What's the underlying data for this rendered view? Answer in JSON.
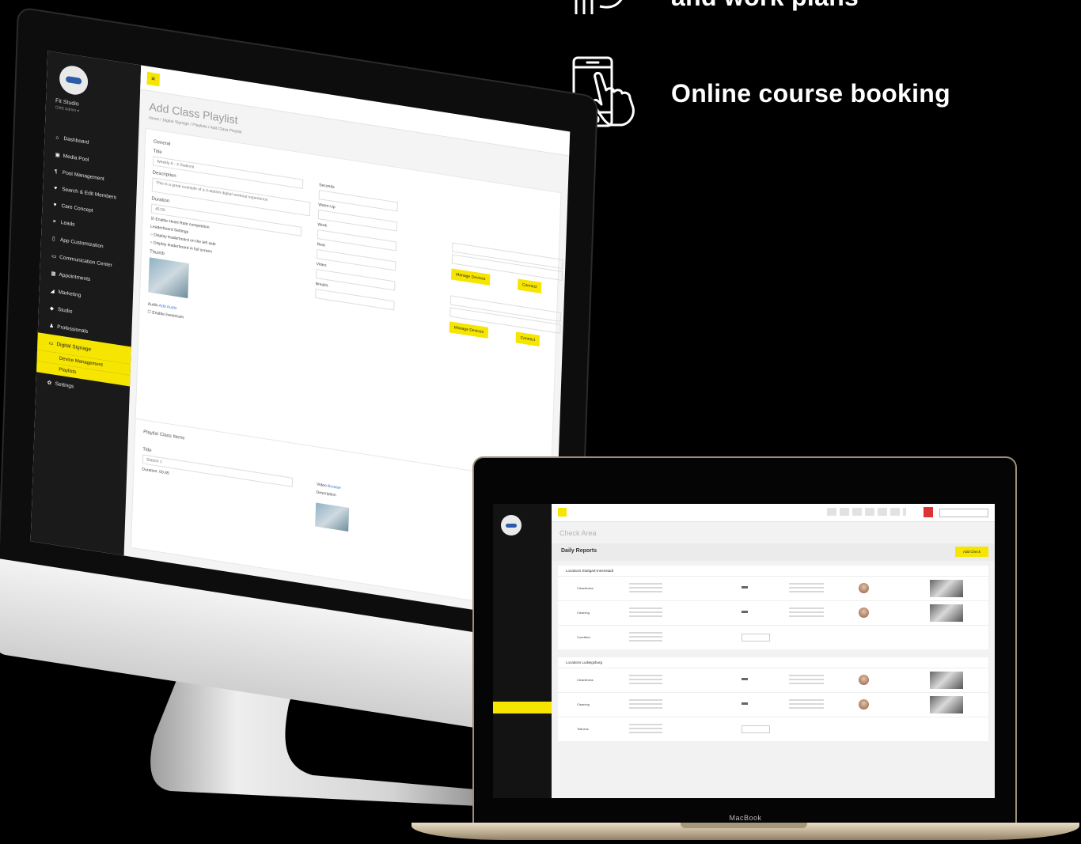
{
  "features": [
    {
      "label": "and work plans",
      "icon": "checklist-icon"
    },
    {
      "label": "Online course booking",
      "icon": "phone-tap-icon"
    }
  ],
  "imac": {
    "sidebar": {
      "studio_name": "Fit Studio",
      "studio_sub": "CMS Admin ▾",
      "items": [
        {
          "label": "Dashboard",
          "icon": "home-icon"
        },
        {
          "label": "Media Pool",
          "icon": "image-icon"
        },
        {
          "label": "Post Management",
          "icon": "pin-icon"
        },
        {
          "label": "Search & Edit Members",
          "icon": "users-icon"
        },
        {
          "label": "Care Concept",
          "icon": "heart-icon"
        },
        {
          "label": "Leads",
          "icon": "list-icon"
        },
        {
          "label": "App Customization",
          "icon": "mobile-icon"
        },
        {
          "label": "Communication Center",
          "icon": "chat-icon"
        },
        {
          "label": "Appointments",
          "icon": "calendar-icon"
        },
        {
          "label": "Marketing",
          "icon": "megaphone-icon"
        },
        {
          "label": "Studio",
          "icon": "building-icon"
        },
        {
          "label": "Professionals",
          "icon": "user-icon"
        },
        {
          "label": "Digital Signage",
          "icon": "monitor-icon",
          "active": true
        },
        {
          "label": "Settings",
          "icon": "gear-icon"
        }
      ],
      "subitems": [
        "Device Management",
        "Playlists"
      ]
    },
    "page_title": "Add Class Playlist",
    "breadcrumb": "Home / Digital Signage / Playlists / Add Class Playlist",
    "form": {
      "section_label": "General",
      "title_label": "Title",
      "title_value": "Weekly A - 4 Stations",
      "description_label": "Description",
      "description_value": "This is a great example of a 4-station digital workout experience",
      "duration_label": "Duration",
      "duration_value": "45:00",
      "heart_rate_label": "Enable Heart Rate competition",
      "leaderboard_label": "Leaderboard Settings",
      "leaderboard_opt1": "Display leaderboard on the left side",
      "leaderboard_opt2": "Display leaderboard in full screen",
      "thumb_label": "Thumb",
      "audio_label": "Audio",
      "add_audio": "Add Audio",
      "enable_livestream": "Enable livestream",
      "seconds_label": "Seconds",
      "warmup_label": "Warm-Up",
      "work_label": "Work",
      "rest_label": "Rest",
      "video_label": "Video",
      "breaks_label": "Breaks",
      "manage_devices": "Manage Devices",
      "connect": "Connect"
    },
    "section2": {
      "title": "Playlist Class Items",
      "item_title_label": "Title",
      "item_title_value": "Station 1",
      "item_duration": "Duration: 00:45",
      "video_label": "Video",
      "no_video": "Browse",
      "file_label": "Description"
    }
  },
  "macbook": {
    "brand_label": "MacBook",
    "page_title": "Check Area",
    "header_title": "Daily Reports",
    "header_button": "Add Check",
    "blocks": [
      {
        "title": "Locations Stuttgart-Innenstadt",
        "rows": [
          "Cleanliness",
          "Cleaning",
          "Condition"
        ]
      },
      {
        "title": "Locations Ludwigsburg",
        "rows": [
          "Cleanliness",
          "Cleaning",
          "Tidiness"
        ]
      }
    ]
  }
}
